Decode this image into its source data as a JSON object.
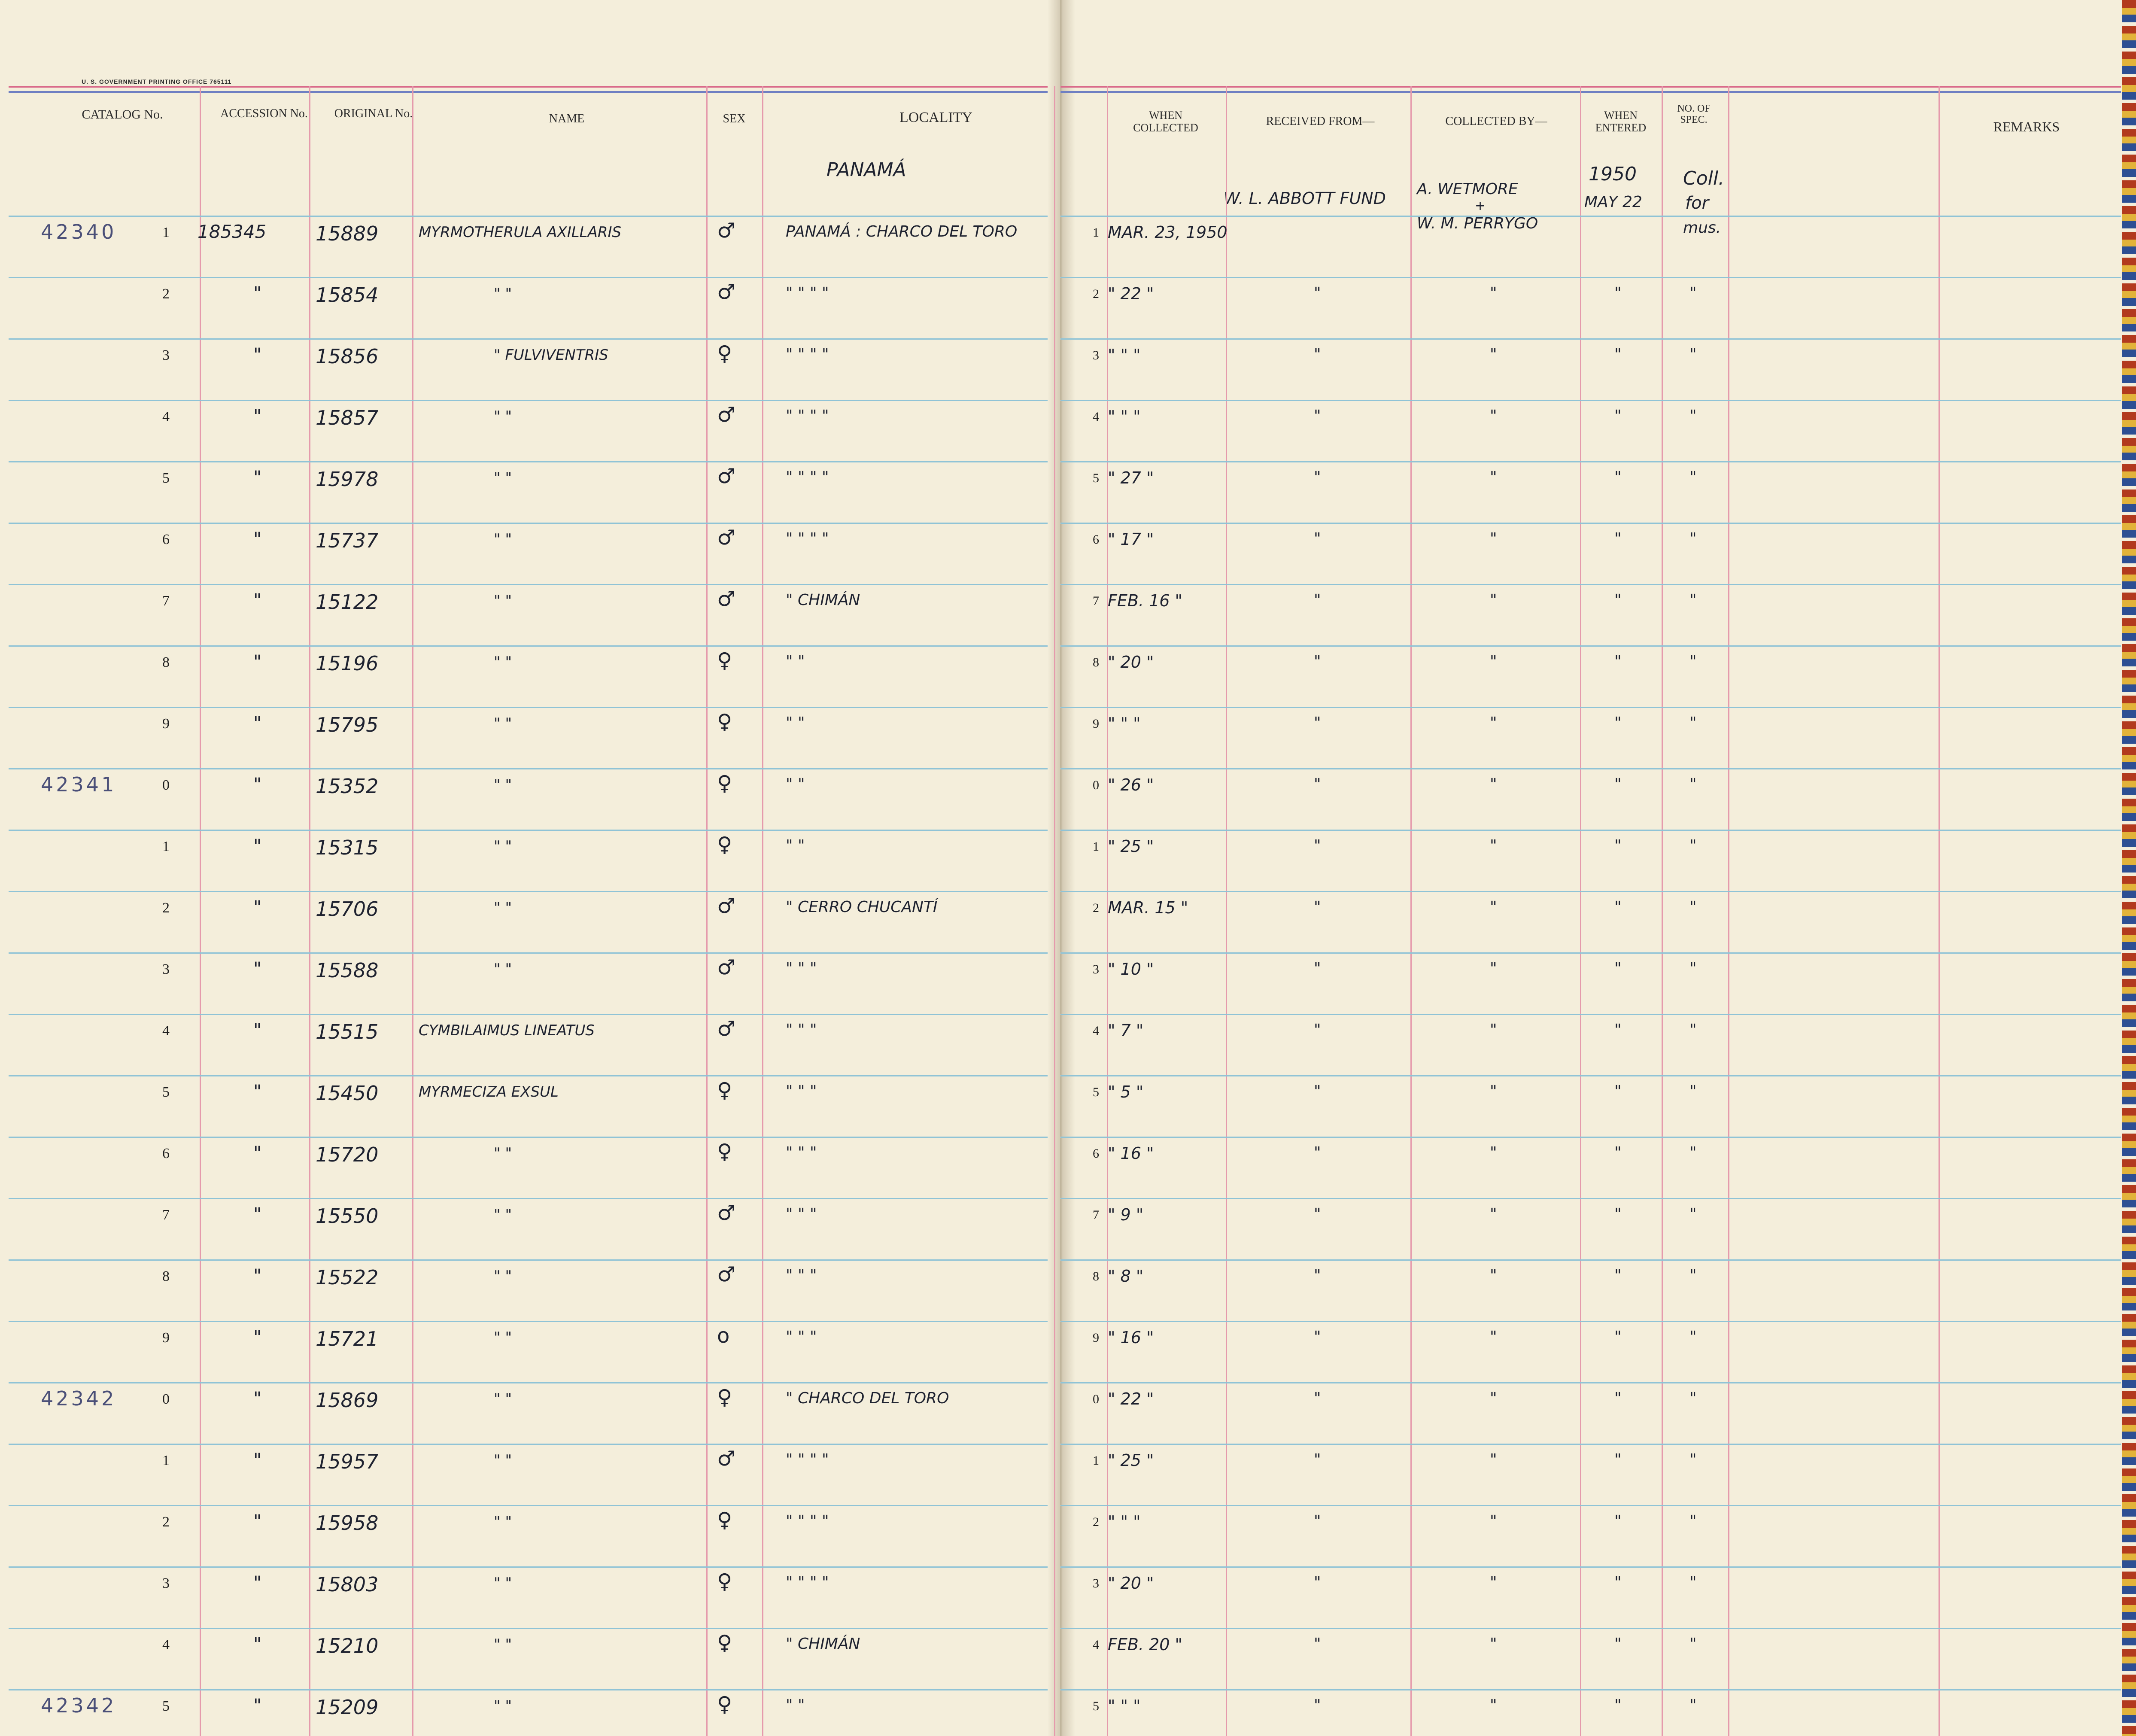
{
  "printer_line": "U. S. GOVERNMENT PRINTING OFFICE    765111",
  "headers": {
    "catalog": "CATALOG No.",
    "accession": "ACCESSION No.",
    "original": "ORIGINAL No.",
    "name": "NAME",
    "sex": "SEX",
    "locality": "LOCALITY",
    "when_collected": "WHEN COLLECTED",
    "received_from": "RECEIVED FROM—",
    "collected_by": "COLLECTED BY—",
    "when_entered": "WHEN ENTERED",
    "no_of_spec": "NO. OF SPEC.",
    "remarks": "REMARKS"
  },
  "top_notes": {
    "locality_heading": "PANAMÁ",
    "received_from": "W. L. ABBOTT FUND",
    "collected_by_1": "A. WETMORE",
    "collected_by_amp": "+",
    "collected_by_2": "W. M. PERRYGO",
    "entered_year": "1950",
    "entered_date": "MAY 22",
    "spec_1": "Coll.",
    "spec_2": "for",
    "spec_3": "mus."
  },
  "rows": [
    {
      "prefix": "42340",
      "digit": "1",
      "accession": "185345",
      "original": "15889",
      "name": "MYRMOTHERULA AXILLARIS",
      "sex": "♂",
      "locality": "PANAMÁ : CHARCO DEL TORO",
      "coll_digit": "1",
      "collected": "MAR. 23, 1950",
      "received": "",
      "collector": "",
      "entered": "",
      "spec": ""
    },
    {
      "prefix": "",
      "digit": "2",
      "accession": "\"",
      "original": "15854",
      "name": "\"           \"",
      "sex": "♂",
      "locality": "\"      \"    \"    \"",
      "coll_digit": "2",
      "collected": "\" 22 \"",
      "received": "\"",
      "collector": "\"",
      "entered": "\"",
      "spec": "\""
    },
    {
      "prefix": "",
      "digit": "3",
      "accession": "\"",
      "original": "15856",
      "name": "\"     FULVIVENTRIS",
      "sex": "♀",
      "locality": "\"      \"    \"    \"",
      "coll_digit": "3",
      "collected": "\"  \"  \"",
      "received": "\"",
      "collector": "\"",
      "entered": "\"",
      "spec": "\""
    },
    {
      "prefix": "",
      "digit": "4",
      "accession": "\"",
      "original": "15857",
      "name": "\"           \"",
      "sex": "♂",
      "locality": "\"      \"    \"    \"",
      "coll_digit": "4",
      "collected": "\"  \"  \"",
      "received": "\"",
      "collector": "\"",
      "entered": "\"",
      "spec": "\""
    },
    {
      "prefix": "",
      "digit": "5",
      "accession": "\"",
      "original": "15978",
      "name": "\"           \"",
      "sex": "♂",
      "locality": "\"      \"    \"    \"",
      "coll_digit": "5",
      "collected": "\" 27 \"",
      "received": "\"",
      "collector": "\"",
      "entered": "\"",
      "spec": "\""
    },
    {
      "prefix": "",
      "digit": "6",
      "accession": "\"",
      "original": "15737",
      "name": "\"           \"",
      "sex": "♂",
      "locality": "\"      \"    \"    \"",
      "coll_digit": "6",
      "collected": "\" 17 \"",
      "received": "\"",
      "collector": "\"",
      "entered": "\"",
      "spec": "\""
    },
    {
      "prefix": "",
      "digit": "7",
      "accession": "\"",
      "original": "15122",
      "name": "\"           \"",
      "sex": "♂",
      "locality": "\"   CHIMÁN",
      "coll_digit": "7",
      "collected": "FEB. 16 \"",
      "received": "\"",
      "collector": "\"",
      "entered": "\"",
      "spec": "\""
    },
    {
      "prefix": "",
      "digit": "8",
      "accession": "\"",
      "original": "15196",
      "name": "\"           \"",
      "sex": "♀",
      "locality": "\"      \"",
      "coll_digit": "8",
      "collected": "\" 20 \"",
      "received": "\"",
      "collector": "\"",
      "entered": "\"",
      "spec": "\""
    },
    {
      "prefix": "",
      "digit": "9",
      "accession": "\"",
      "original": "15795",
      "name": "\"           \"",
      "sex": "♀",
      "locality": "\"      \"",
      "coll_digit": "9",
      "collected": "\"  \"  \"",
      "received": "\"",
      "collector": "\"",
      "entered": "\"",
      "spec": "\""
    },
    {
      "prefix": "42341",
      "digit": "0",
      "accession": "\"",
      "original": "15352",
      "name": "\"           \"",
      "sex": "♀",
      "locality": "\"      \"",
      "coll_digit": "0",
      "collected": "\" 26 \"",
      "received": "\"",
      "collector": "\"",
      "entered": "\"",
      "spec": "\""
    },
    {
      "prefix": "",
      "digit": "1",
      "accession": "\"",
      "original": "15315",
      "name": "\"           \"",
      "sex": "♀",
      "locality": "\"      \"",
      "coll_digit": "1",
      "collected": "\" 25 \"",
      "received": "\"",
      "collector": "\"",
      "entered": "\"",
      "spec": "\""
    },
    {
      "prefix": "",
      "digit": "2",
      "accession": "\"",
      "original": "15706",
      "name": "\"           \"",
      "sex": "♂",
      "locality": "\"   CERRO CHUCANTÍ",
      "coll_digit": "2",
      "collected": "MAR. 15 \"",
      "received": "\"",
      "collector": "\"",
      "entered": "\"",
      "spec": "\""
    },
    {
      "prefix": "",
      "digit": "3",
      "accession": "\"",
      "original": "15588",
      "name": "\"           \"",
      "sex": "♂",
      "locality": "\"      \"     \"",
      "coll_digit": "3",
      "collected": "\" 10 \"",
      "received": "\"",
      "collector": "\"",
      "entered": "\"",
      "spec": "\""
    },
    {
      "prefix": "",
      "digit": "4",
      "accession": "\"",
      "original": "15515",
      "name": "CYMBILAIMUS LINEATUS",
      "sex": "♂",
      "locality": "\"      \"     \"",
      "coll_digit": "4",
      "collected": "\" 7 \"",
      "received": "\"",
      "collector": "\"",
      "entered": "\"",
      "spec": "\""
    },
    {
      "prefix": "",
      "digit": "5",
      "accession": "\"",
      "original": "15450",
      "name": "MYRMECIZA EXSUL",
      "sex": "♀",
      "locality": "\"      \"     \"",
      "coll_digit": "5",
      "collected": "\" 5 \"",
      "received": "\"",
      "collector": "\"",
      "entered": "\"",
      "spec": "\""
    },
    {
      "prefix": "",
      "digit": "6",
      "accession": "\"",
      "original": "15720",
      "name": "\"           \"",
      "sex": "♀",
      "locality": "\"      \"     \"",
      "coll_digit": "6",
      "collected": "\" 16 \"",
      "received": "\"",
      "collector": "\"",
      "entered": "\"",
      "spec": "\""
    },
    {
      "prefix": "",
      "digit": "7",
      "accession": "\"",
      "original": "15550",
      "name": "\"           \"",
      "sex": "♂",
      "locality": "\"      \"     \"",
      "coll_digit": "7",
      "collected": "\" 9 \"",
      "received": "\"",
      "collector": "\"",
      "entered": "\"",
      "spec": "\""
    },
    {
      "prefix": "",
      "digit": "8",
      "accession": "\"",
      "original": "15522",
      "name": "\"           \"",
      "sex": "♂",
      "locality": "\"      \"     \"",
      "coll_digit": "8",
      "collected": "\" 8 \"",
      "received": "\"",
      "collector": "\"",
      "entered": "\"",
      "spec": "\""
    },
    {
      "prefix": "",
      "digit": "9",
      "accession": "\"",
      "original": "15721",
      "name": "\"           \"",
      "sex": "o",
      "locality": "\"      \"     \"",
      "coll_digit": "9",
      "collected": "\" 16 \"",
      "received": "\"",
      "collector": "\"",
      "entered": "\"",
      "spec": "\""
    },
    {
      "prefix": "42342",
      "digit": "0",
      "accession": "\"",
      "original": "15869",
      "name": "\"           \"",
      "sex": "♀",
      "locality": "\"   CHARCO DEL TORO",
      "coll_digit": "0",
      "collected": "\" 22 \"",
      "received": "\"",
      "collector": "\"",
      "entered": "\"",
      "spec": "\""
    },
    {
      "prefix": "",
      "digit": "1",
      "accession": "\"",
      "original": "15957",
      "name": "\"           \"",
      "sex": "♂",
      "locality": "\"      \"    \"    \"",
      "coll_digit": "1",
      "collected": "\" 25 \"",
      "received": "\"",
      "collector": "\"",
      "entered": "\"",
      "spec": "\""
    },
    {
      "prefix": "",
      "digit": "2",
      "accession": "\"",
      "original": "15958",
      "name": "\"           \"",
      "sex": "♀",
      "locality": "\"      \"    \"    \"",
      "coll_digit": "2",
      "collected": "\"  \"  \"",
      "received": "\"",
      "collector": "\"",
      "entered": "\"",
      "spec": "\""
    },
    {
      "prefix": "",
      "digit": "3",
      "accession": "\"",
      "original": "15803",
      "name": "\"           \"",
      "sex": "♀",
      "locality": "\"      \"    \"    \"",
      "coll_digit": "3",
      "collected": "\" 20 \"",
      "received": "\"",
      "collector": "\"",
      "entered": "\"",
      "spec": "\""
    },
    {
      "prefix": "",
      "digit": "4",
      "accession": "\"",
      "original": "15210",
      "name": "\"           \"",
      "sex": "♀",
      "locality": "\"   CHIMÁN",
      "coll_digit": "4",
      "collected": "FEB. 20 \"",
      "received": "\"",
      "collector": "\"",
      "entered": "\"",
      "spec": "\""
    },
    {
      "prefix": "42342",
      "digit": "5",
      "accession": "\"",
      "original": "15209",
      "name": "\"           \"",
      "sex": "♀",
      "locality": "\"      \"",
      "coll_digit": "5",
      "collected": "\"  \"  \"",
      "received": "\"",
      "collector": "\"",
      "entered": "\"",
      "spec": "\""
    }
  ]
}
